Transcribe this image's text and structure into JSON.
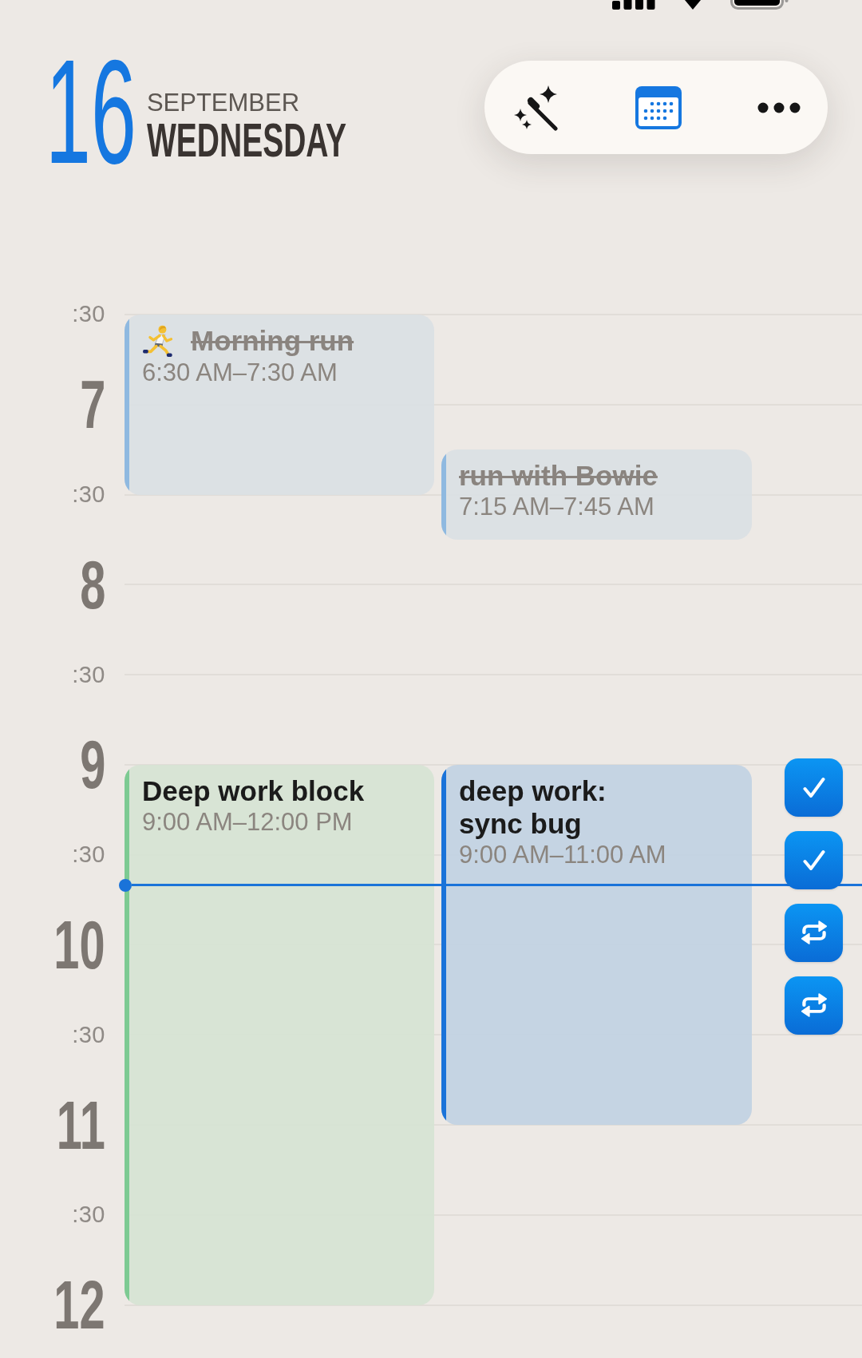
{
  "date": {
    "day": "16",
    "month": "SEPTEMBER",
    "weekday": "WEDNESDAY"
  },
  "timeline": {
    "labels": [
      {
        "kind": "half",
        "text": ":30"
      },
      {
        "kind": "hour",
        "text": "7"
      },
      {
        "kind": "half",
        "text": ":30"
      },
      {
        "kind": "hour",
        "text": "8"
      },
      {
        "kind": "half",
        "text": ":30"
      },
      {
        "kind": "hour",
        "text": "9"
      },
      {
        "kind": "half",
        "text": ":30"
      },
      {
        "kind": "hour",
        "text": "10"
      },
      {
        "kind": "half",
        "text": ":30"
      },
      {
        "kind": "hour",
        "text": "11"
      },
      {
        "kind": "half",
        "text": ":30"
      },
      {
        "kind": "hour",
        "text": "12"
      }
    ]
  },
  "events": [
    {
      "title": "Morning run",
      "time": "6:30 AM–7:30 AM",
      "done": true,
      "icon": true,
      "color": "#8fb9e0"
    },
    {
      "title": "run with Bowie",
      "time": "7:15 AM–7:45 AM",
      "done": true,
      "icon": false,
      "color": "#8fb9e0"
    },
    {
      "title": "Deep work block",
      "time": "9:00 AM–12:00 PM",
      "done": false,
      "icon": false,
      "color": "#7dca92"
    },
    {
      "title": "deep work:\nsync bug",
      "time": "9:00 AM–11:00 AM",
      "done": false,
      "icon": false,
      "color": "#1a73d9"
    }
  ],
  "tasks": [
    {
      "kind": "check"
    },
    {
      "kind": "check"
    },
    {
      "kind": "repeat"
    },
    {
      "kind": "repeat"
    }
  ]
}
